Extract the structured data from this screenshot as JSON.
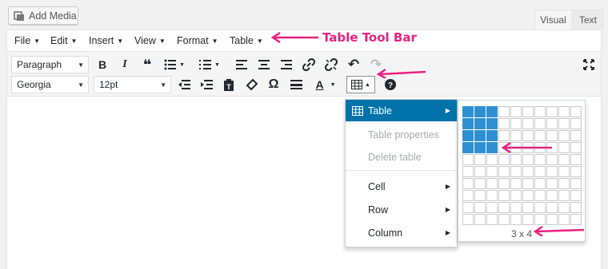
{
  "media": {
    "add_media_label": "Add Media"
  },
  "tabs": {
    "visual": "Visual",
    "text": "Text"
  },
  "menubar": {
    "items": [
      "File",
      "Edit",
      "Insert",
      "View",
      "Format",
      "Table"
    ]
  },
  "annotation": {
    "label": "Table Tool Bar",
    "color": "#e9217f"
  },
  "toolbar": {
    "format_select": "Paragraph",
    "font_family_select": "Georgia",
    "font_size_select": "12pt",
    "row1_icons": [
      "bold-icon",
      "italic-icon",
      "blockquote-icon",
      "bullet-list-icon",
      "numbered-list-icon",
      "align-left-icon",
      "align-center-icon",
      "align-right-icon",
      "link-icon",
      "unlink-icon",
      "undo-icon",
      "redo-icon",
      "fullscreen-icon"
    ],
    "row2_icons": [
      "outdent-icon",
      "indent-icon",
      "paste-text-icon",
      "clear-format-icon",
      "omega-icon",
      "horizontal-rule-icon",
      "text-color-icon",
      "table-icon",
      "help-icon"
    ]
  },
  "table_menu": {
    "table": "Table",
    "table_properties": "Table properties",
    "delete_table": "Delete table",
    "cell": "Cell",
    "row": "Row",
    "column": "Column"
  },
  "table_grid": {
    "cols": 10,
    "rows": 10,
    "selected_cols": 3,
    "selected_rows": 4,
    "size_label": "3 x 4",
    "accent": "#2e8fd3"
  },
  "colors": {
    "accent": "#0073aa"
  }
}
